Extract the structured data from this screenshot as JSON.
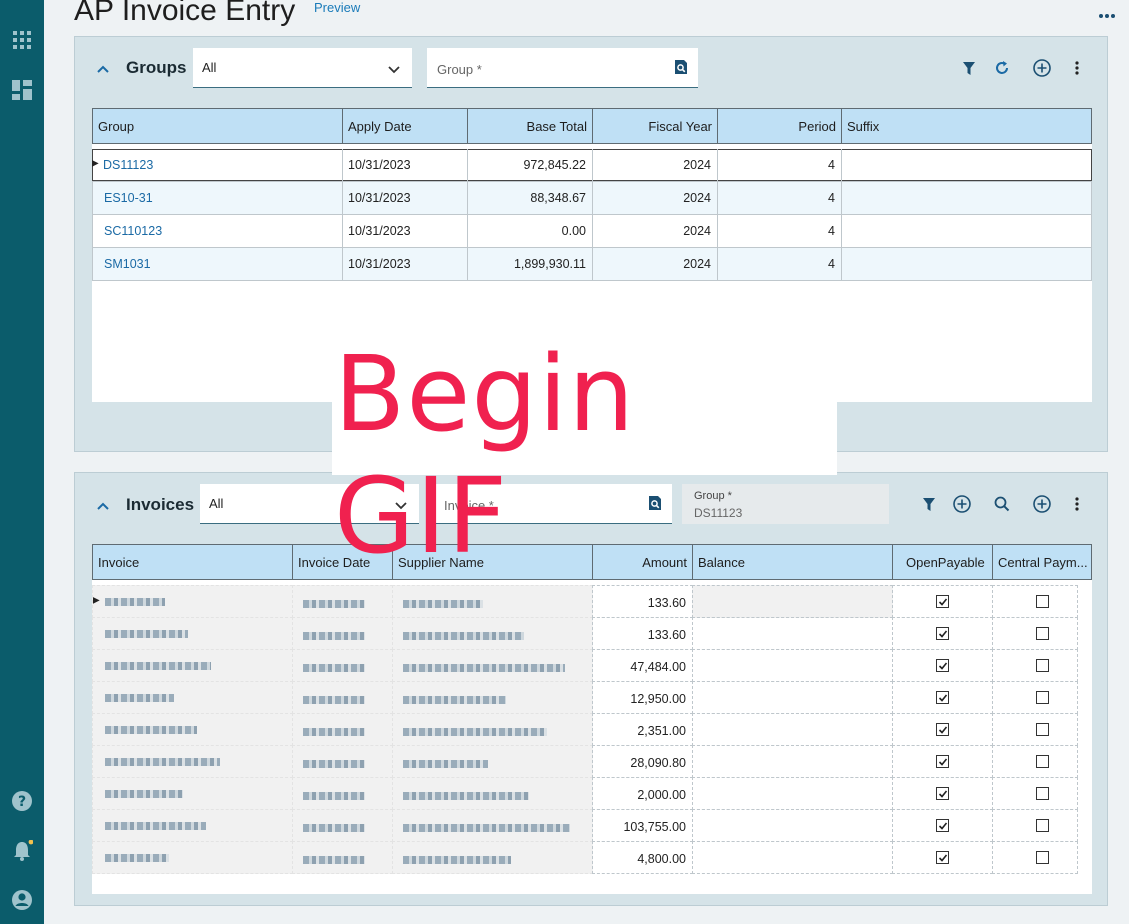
{
  "app": {
    "title": "AP Invoice Entry",
    "preview_label": "Preview",
    "overlay_text": "Begin GIF",
    "accent": "#0b5c6b",
    "link_color": "#1b6aa5",
    "overlay_color": "#f0214f"
  },
  "groups": {
    "title": "Groups",
    "filter_value": "All",
    "search_placeholder": "Group *",
    "columns": [
      "Group",
      "Apply Date",
      "Base Total",
      "Fiscal Year",
      "Period",
      "Suffix"
    ],
    "rows": [
      {
        "group": "DS11123",
        "apply_date": "10/31/2023",
        "base_total": "972,845.22",
        "fiscal_year": "2024",
        "period": "4",
        "suffix": ""
      },
      {
        "group": "ES10-31",
        "apply_date": "10/31/2023",
        "base_total": "88,348.67",
        "fiscal_year": "2024",
        "period": "4",
        "suffix": ""
      },
      {
        "group": "SC110123",
        "apply_date": "10/31/2023",
        "base_total": "0.00",
        "fiscal_year": "2024",
        "period": "4",
        "suffix": ""
      },
      {
        "group": "SM1031",
        "apply_date": "10/31/2023",
        "base_total": "1,899,930.11",
        "fiscal_year": "2024",
        "period": "4",
        "suffix": ""
      }
    ]
  },
  "invoices": {
    "title": "Invoices",
    "filter_value": "All",
    "search_placeholder": "Invoice *",
    "group_field": {
      "label": "Group *",
      "value": "DS11123"
    },
    "columns": [
      "Invoice",
      "Invoice Date",
      "Supplier Name",
      "Amount",
      "Balance",
      "OpenPayable",
      "Central Paym..."
    ],
    "rows": [
      {
        "amount": "133.60",
        "open_payable": true,
        "central_payment": false
      },
      {
        "amount": "133.60",
        "open_payable": true,
        "central_payment": false
      },
      {
        "amount": "47,484.00",
        "open_payable": true,
        "central_payment": false
      },
      {
        "amount": "12,950.00",
        "open_payable": true,
        "central_payment": false
      },
      {
        "amount": "2,351.00",
        "open_payable": true,
        "central_payment": false
      },
      {
        "amount": "28,090.80",
        "open_payable": true,
        "central_payment": false
      },
      {
        "amount": "2,000.00",
        "open_payable": true,
        "central_payment": false
      },
      {
        "amount": "103,755.00",
        "open_payable": true,
        "central_payment": false
      },
      {
        "amount": "4,800.00",
        "open_payable": true,
        "central_payment": false
      }
    ]
  },
  "icons": {
    "rail": [
      "apps-grid-icon",
      "dashboard-icon",
      "help-icon",
      "bell-icon",
      "user-icon"
    ],
    "toolbar": [
      "filter-icon",
      "refresh-icon",
      "add-circle-icon",
      "kebab-icon",
      "search-icon"
    ]
  }
}
